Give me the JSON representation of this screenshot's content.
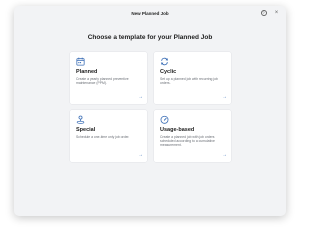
{
  "window": {
    "title": "New Planned Job"
  },
  "titlebar": {
    "help_icon": "help-circle-icon",
    "close_icon": "close-icon",
    "help_glyph": "?",
    "close_glyph": "×"
  },
  "heading": "Choose a template for your Planned Job",
  "accent_color": "#3a6db5",
  "templates": [
    {
      "title": "Planned",
      "description": "Create a yearly planned preventive maintenance (PPM).",
      "icon": "calendar-icon"
    },
    {
      "title": "Cyclic",
      "description": "Set up a planned job with recurring job orders.",
      "icon": "cycle-arrows-icon"
    },
    {
      "title": "Special",
      "description": "Schedule a one-time only job order.",
      "icon": "person-pin-icon"
    },
    {
      "title": "Usage-based",
      "description": "Create a planned job with job orders scheduled according to a cumulative measurement.",
      "icon": "gauge-icon"
    }
  ],
  "arrow_glyph": "→"
}
